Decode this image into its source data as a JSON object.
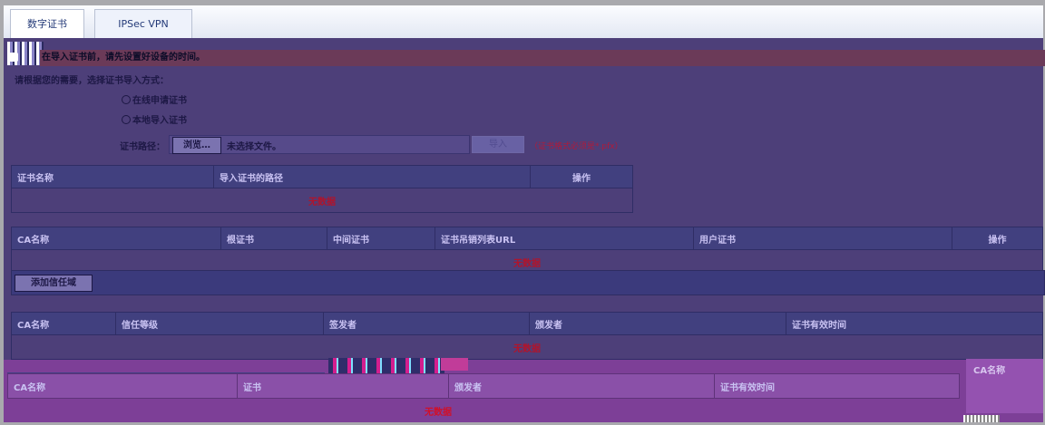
{
  "tabs": [
    {
      "label": "数字证书",
      "active": true
    },
    {
      "label": "IPSec VPN",
      "active": false
    }
  ],
  "notice": "在导入证书前，请先设置好设备的时间。",
  "import": {
    "prompt": "请根据您的需要，选择证书导入方式：",
    "option_apply": "在线申请证书",
    "option_local": "本地导入证书",
    "path_label": "证书路径：",
    "browse_label": "浏览…",
    "file_status": "未选择文件。",
    "import_label": "导入",
    "hint": "（证书格式必须是*.pfx）"
  },
  "cert_table": {
    "headers": [
      "证书名称",
      "导入证书的路径",
      "操作"
    ],
    "empty_text": "无数据"
  },
  "ca_table": {
    "headers": [
      "CA名称",
      "根证书",
      "中间证书",
      "证书吊销列表URL",
      "用户证书",
      "操作"
    ],
    "empty_text": "无数据"
  },
  "add_button": "添加信任域",
  "trust_table": {
    "headers": [
      "CA名称",
      "信任等级",
      "签发者",
      "颁发者",
      "证书有效时间"
    ],
    "empty_text": "无数据"
  },
  "lower_table": {
    "headers": [
      "CA名称",
      "证书",
      "颁发者",
      "证书有效时间"
    ],
    "empty_text": "无数据"
  },
  "right_label": "CA名称"
}
